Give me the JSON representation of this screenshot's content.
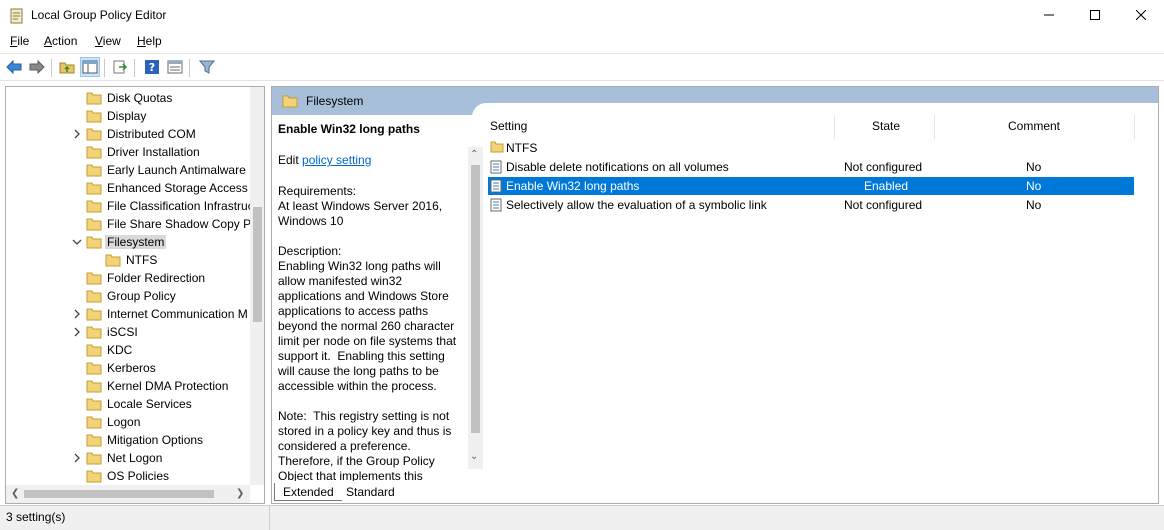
{
  "window": {
    "title": "Local Group Policy Editor",
    "minimize_icon": "minimize-icon",
    "maximize_icon": "maximize-icon",
    "close_icon": "close-icon"
  },
  "menu": {
    "items": [
      {
        "label": "File",
        "accel": "F"
      },
      {
        "label": "Action",
        "accel": "A"
      },
      {
        "label": "View",
        "accel": "V"
      },
      {
        "label": "Help",
        "accel": "H"
      }
    ]
  },
  "toolbar": {
    "buttons": [
      "back-icon",
      "forward-icon",
      "up-folder-icon",
      "show-hide-tree-icon",
      "export-list-icon",
      "help-icon",
      "properties-icon",
      "filter-icon"
    ]
  },
  "tree": {
    "items": [
      {
        "label": "Disk Quotas",
        "expandable": false
      },
      {
        "label": "Display",
        "expandable": false
      },
      {
        "label": "Distributed COM",
        "expandable": true
      },
      {
        "label": "Driver Installation",
        "expandable": false
      },
      {
        "label": "Early Launch Antimalware",
        "expandable": false
      },
      {
        "label": "Enhanced Storage Access",
        "expandable": false
      },
      {
        "label": "File Classification Infrastruc",
        "expandable": false
      },
      {
        "label": "File Share Shadow Copy Pr",
        "expandable": false
      },
      {
        "label": "Filesystem",
        "expandable": true,
        "expanded": true,
        "selected": true
      },
      {
        "label": "NTFS",
        "expandable": false,
        "child": true
      },
      {
        "label": "Folder Redirection",
        "expandable": false
      },
      {
        "label": "Group Policy",
        "expandable": false
      },
      {
        "label": "Internet Communication M",
        "expandable": true
      },
      {
        "label": "iSCSI",
        "expandable": true
      },
      {
        "label": "KDC",
        "expandable": false
      },
      {
        "label": "Kerberos",
        "expandable": false
      },
      {
        "label": "Kernel DMA Protection",
        "expandable": false
      },
      {
        "label": "Locale Services",
        "expandable": false
      },
      {
        "label": "Logon",
        "expandable": false
      },
      {
        "label": "Mitigation Options",
        "expandable": false
      },
      {
        "label": "Net Logon",
        "expandable": true
      },
      {
        "label": "OS Policies",
        "expandable": false
      }
    ]
  },
  "right": {
    "header": "Filesystem",
    "description": {
      "title": "Enable Win32 long paths",
      "edit_prefix": "Edit ",
      "edit_link": "policy setting",
      "requirements": "Requirements:\nAt least Windows Server 2016, Windows 10",
      "description": "Description:\nEnabling Win32 long paths will allow manifested win32 applications and Windows Store applications to access paths beyond the normal 260 character limit per node on file systems that support it.  Enabling this setting will cause the long paths to be accessible within the process.",
      "note": "Note:  This registry setting is not stored in a policy key and thus is considered a preference. Therefore, if the Group Policy Object that implements this"
    },
    "columns": {
      "setting": "Setting",
      "state": "State",
      "comment": "Comment"
    },
    "folder_row": "NTFS",
    "rows": [
      {
        "name": "Disable delete notifications on all volumes",
        "state": "Not configured",
        "comment": "No",
        "selected": false
      },
      {
        "name": "Enable Win32 long paths",
        "state": "Enabled",
        "comment": "No",
        "selected": true
      },
      {
        "name": "Selectively allow the evaluation of a symbolic link",
        "state": "Not configured",
        "comment": "No",
        "selected": false
      }
    ],
    "tabs": [
      "Extended",
      "Standard"
    ]
  },
  "status": {
    "text": "3 setting(s)"
  },
  "colors": {
    "selection": "#0078d7",
    "header_band": "#a7bfd8",
    "link": "#0066cc"
  }
}
